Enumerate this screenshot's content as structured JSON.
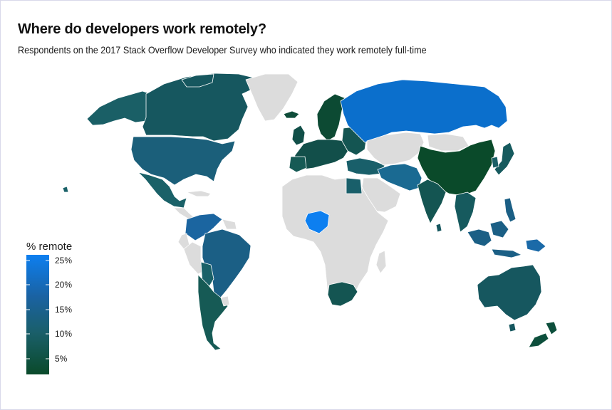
{
  "header": {
    "title": "Where do developers work remotely?",
    "subtitle": "Respondents on the 2017 Stack Overflow Developer Survey who indicated they work remotely full-time"
  },
  "legend": {
    "title": "% remote",
    "ticks": [
      "25%",
      "20%",
      "15%",
      "10%",
      "5%"
    ],
    "color_low": "#0a4a2a",
    "color_high": "#0d7ff0"
  },
  "colors": {
    "no_data": "#dcdcdc",
    "border": "#ffffff"
  },
  "map_data": {
    "variable": "% remote",
    "regions": [
      {
        "name": "Canada",
        "level": "11%"
      },
      {
        "name": "Alaska",
        "level": "12%"
      },
      {
        "name": "United States",
        "level": "14%"
      },
      {
        "name": "Mexico",
        "level": "12%"
      },
      {
        "name": "Greenland",
        "level": "no data"
      },
      {
        "name": "Colombia / Venezuela",
        "level": "15%"
      },
      {
        "name": "Brazil",
        "level": "15%"
      },
      {
        "name": "Peru / Bolivia / Paraguay",
        "level": "14%"
      },
      {
        "name": "Argentina / Chile",
        "level": "10%"
      },
      {
        "name": "Europe",
        "level": "9%"
      },
      {
        "name": "Scandinavia",
        "level": "6%"
      },
      {
        "name": "Russia",
        "level": "22%"
      },
      {
        "name": "China",
        "level": "5%"
      },
      {
        "name": "Mongolia",
        "level": "no data"
      },
      {
        "name": "Central Asia",
        "level": "no data"
      },
      {
        "name": "Middle East",
        "level": "12%"
      },
      {
        "name": "Arabian Peninsula",
        "level": "no data"
      },
      {
        "name": "Iran / Pakistan",
        "level": "15%"
      },
      {
        "name": "India",
        "level": "10%"
      },
      {
        "name": "Southeast Asia",
        "level": "12%"
      },
      {
        "name": "Japan",
        "level": "11%"
      },
      {
        "name": "Philippines",
        "level": "14%"
      },
      {
        "name": "Indonesia",
        "level": "14%"
      },
      {
        "name": "Egypt",
        "level": "9%"
      },
      {
        "name": "Nigeria",
        "level": "25%"
      },
      {
        "name": "South Africa",
        "level": "10%"
      },
      {
        "name": "Rest of Africa",
        "level": "no data"
      },
      {
        "name": "Australia",
        "level": "11%"
      },
      {
        "name": "New Zealand",
        "level": "7%"
      }
    ]
  }
}
